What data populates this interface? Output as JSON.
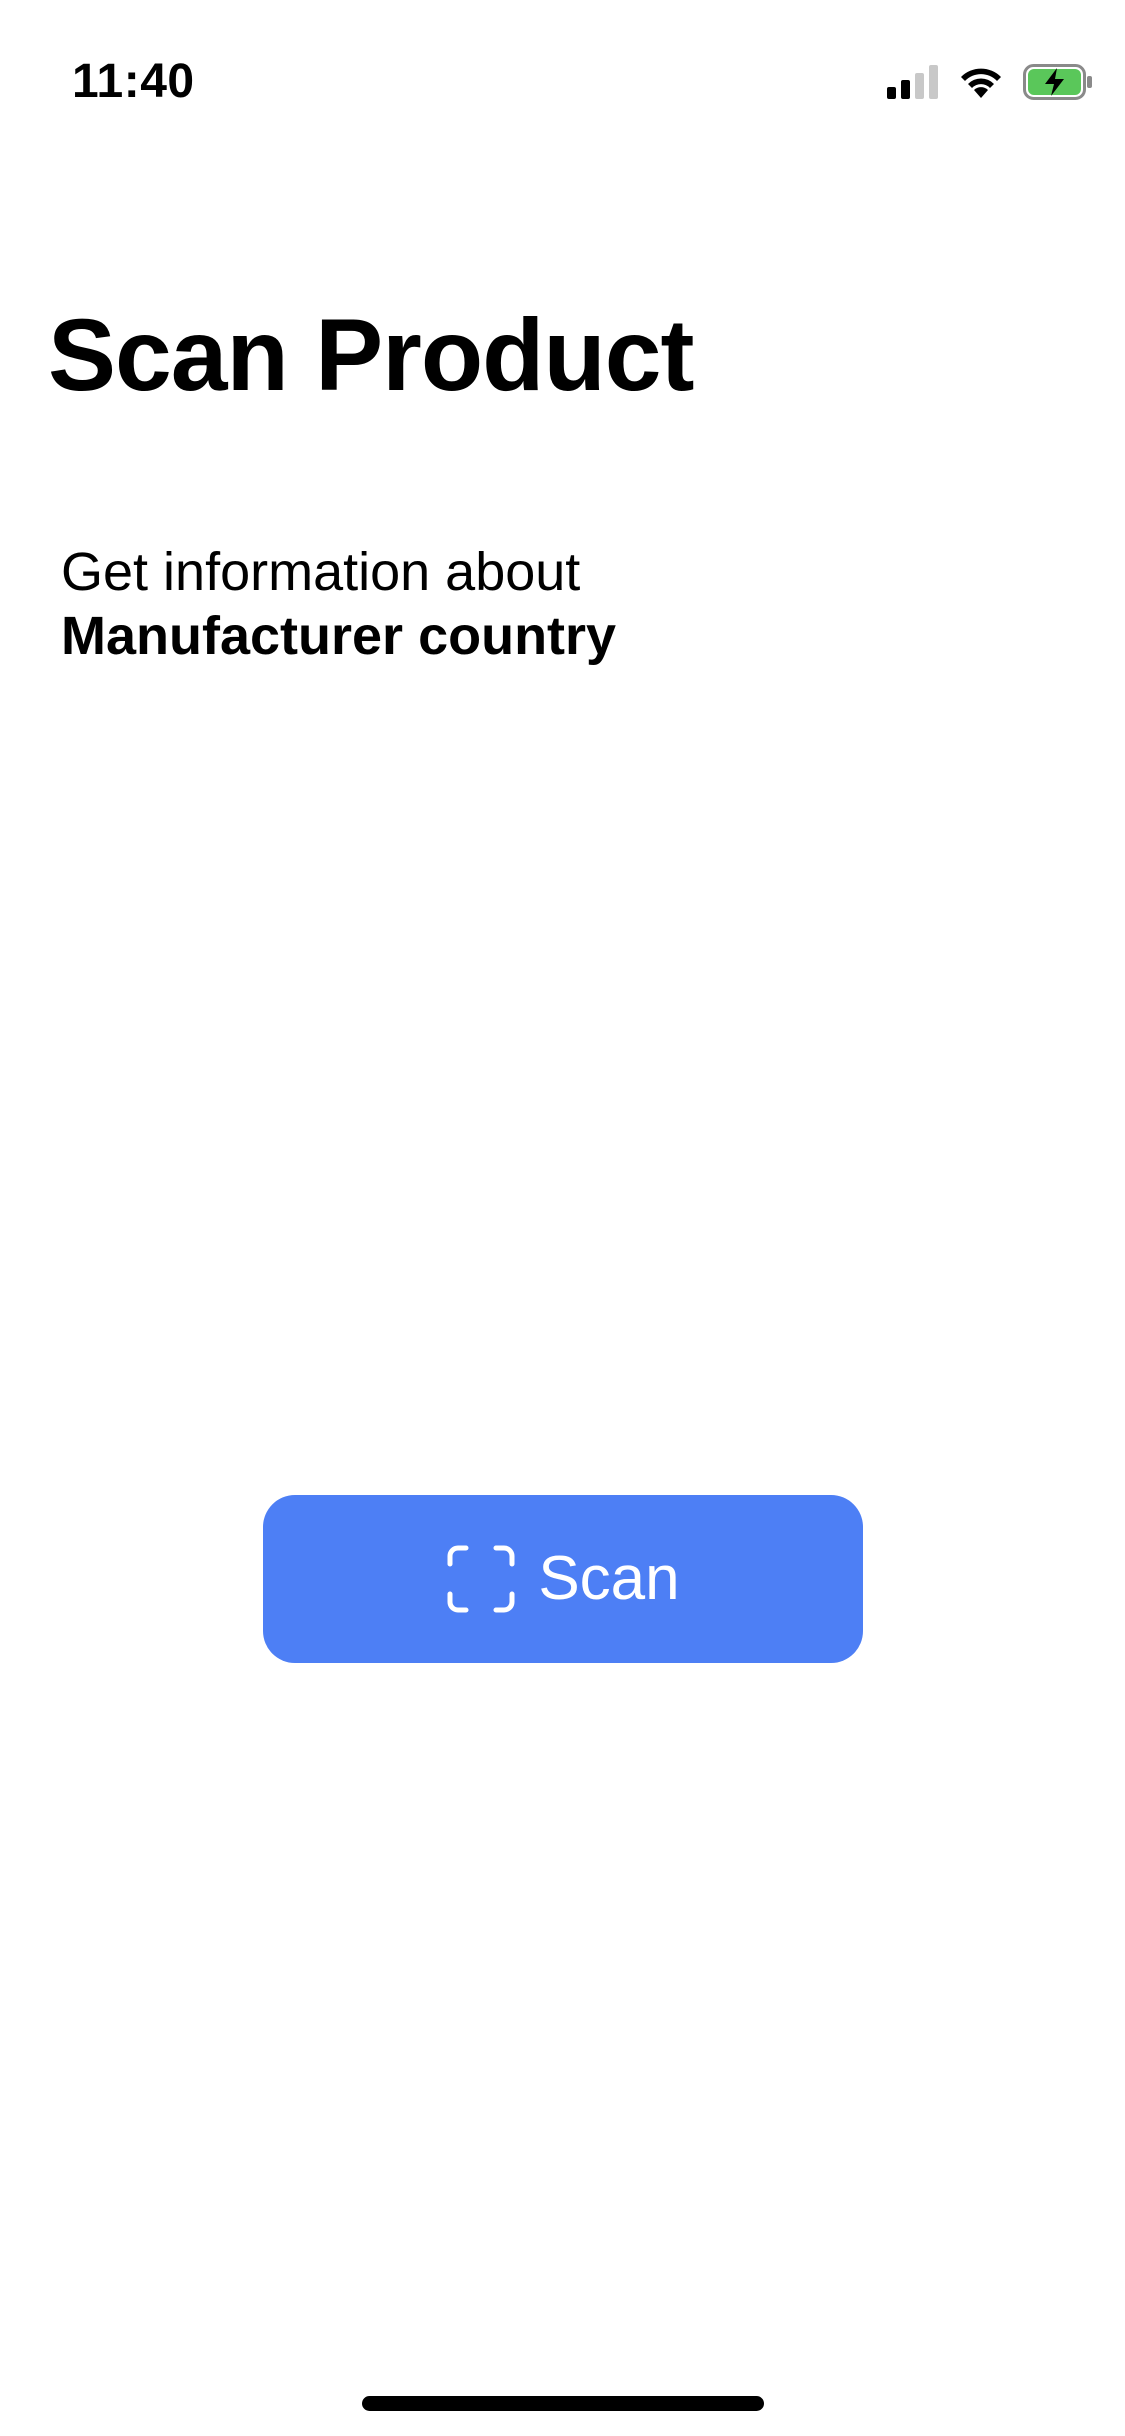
{
  "status_bar": {
    "time": "11:40",
    "signal_icon": "cellular-signal-icon",
    "wifi_icon": "wifi-icon",
    "battery_icon": "battery-charging-icon",
    "battery_color": "#5ac75a"
  },
  "header": {
    "title": "Scan Product"
  },
  "main": {
    "subtitle_line_1": "Get information about",
    "subtitle_line_2": "Manufacturer country"
  },
  "scan_button": {
    "label": "Scan",
    "icon": "viewfinder-icon",
    "color": "#4d7ff5"
  }
}
